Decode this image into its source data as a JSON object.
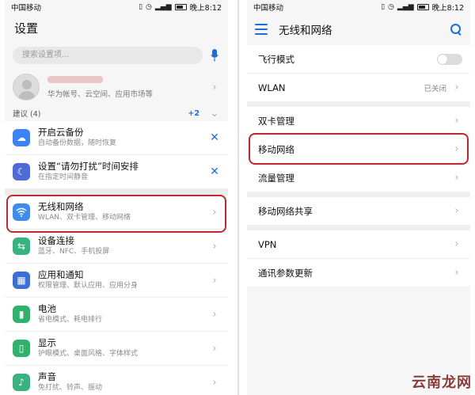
{
  "left": {
    "status": {
      "carrier": "中国移动",
      "time": "晚上8:12"
    },
    "title": "设置",
    "search_placeholder": "搜索设置项...",
    "account": {
      "subtitle": "华为帐号、云空间、应用市场等"
    },
    "suggestions": {
      "label": "建议 (4)",
      "count": "+2"
    },
    "suggestion_items": [
      {
        "title": "开启云备份",
        "subtitle": "自动备份数据，随时恢复",
        "icon": "cloud-backup-icon",
        "color": "#3b82f6"
      },
      {
        "title": "设置“请勿打扰”时间安排",
        "subtitle": "在指定时间静音",
        "icon": "moon-icon",
        "color": "#4f6bd8"
      }
    ],
    "items": [
      {
        "title": "无线和网络",
        "subtitle": "WLAN、双卡管理、移动网络",
        "icon": "wifi-icon",
        "color": "#3f8cf0",
        "glyph": "≋"
      },
      {
        "title": "设备连接",
        "subtitle": "蓝牙、NFC、手机投屏",
        "icon": "device-connection-icon",
        "color": "#36b37e",
        "glyph": "⇆"
      },
      {
        "title": "应用和通知",
        "subtitle": "权限管理、默认应用、应用分身",
        "icon": "apps-icon",
        "color": "#3b6fd8",
        "glyph": "▦"
      },
      {
        "title": "电池",
        "subtitle": "省电模式、耗电排行",
        "icon": "battery-icon",
        "color": "#2fb36a",
        "glyph": "▮"
      },
      {
        "title": "显示",
        "subtitle": "护眼模式、桌面风格、字体样式",
        "icon": "display-icon",
        "color": "#2fb36a",
        "glyph": "▯"
      },
      {
        "title": "声音",
        "subtitle": "免打扰、铃声、振动",
        "icon": "sound-icon",
        "color": "#36b37e",
        "glyph": "♪"
      }
    ]
  },
  "right": {
    "status": {
      "carrier": "中国移动",
      "time": "晚上8:12"
    },
    "title": "无线和网络",
    "groups": [
      [
        {
          "label": "飞行模式",
          "control": "toggle"
        },
        {
          "label": "WLAN",
          "value": "已关闭",
          "control": "chevron"
        }
      ],
      [
        {
          "label": "双卡管理",
          "control": "chevron"
        },
        {
          "label": "移动网络",
          "control": "chevron"
        },
        {
          "label": "流量管理",
          "control": "chevron"
        }
      ],
      [
        {
          "label": "移动网络共享",
          "control": "chevron"
        }
      ],
      [
        {
          "label": "VPN",
          "control": "chevron"
        },
        {
          "label": "通讯参数更新",
          "control": "chevron"
        }
      ]
    ]
  },
  "watermark": "云南龙网",
  "colors": {
    "accent": "#1a6fdb",
    "highlight": "#c3282f"
  }
}
